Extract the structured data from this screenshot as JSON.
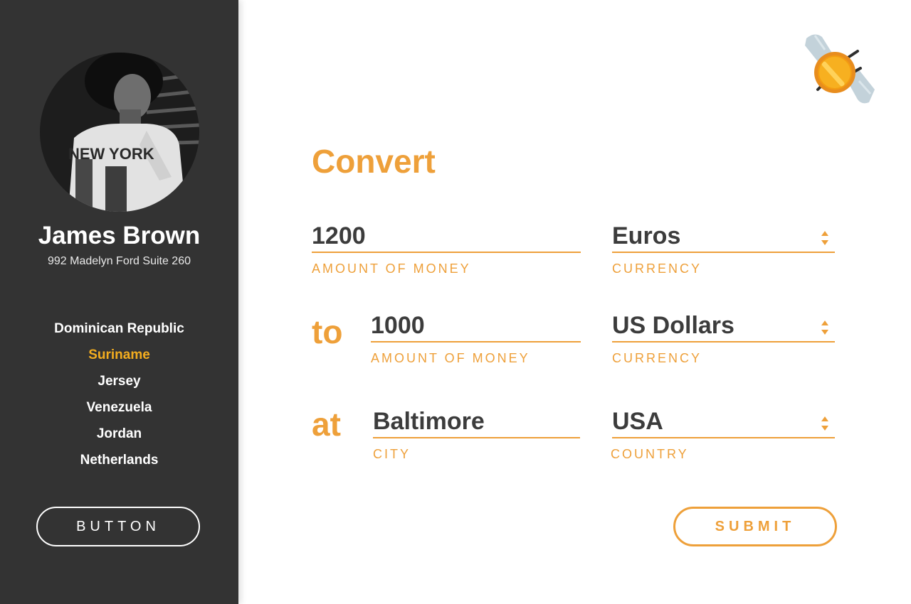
{
  "user": {
    "name": "James Brown",
    "address": "992 Madelyn Ford Suite 260",
    "avatar_shirt_text": "NEW YORK"
  },
  "nav": {
    "items": [
      {
        "label": "Dominican Republic",
        "active": false
      },
      {
        "label": "Suriname",
        "active": true
      },
      {
        "label": "Jersey",
        "active": false
      },
      {
        "label": "Venezuela",
        "active": false
      },
      {
        "label": "Jordan",
        "active": false
      },
      {
        "label": "Netherlands",
        "active": false
      }
    ]
  },
  "sidebar_button": "BUTTON",
  "logo": {
    "icon": "coin-bee-icon"
  },
  "form": {
    "title": "Convert",
    "from_amount": {
      "value": "1200",
      "label": "AMOUNT OF MONEY"
    },
    "from_currency": {
      "value": "Euros",
      "label": "CURRENCY"
    },
    "to_word": "to",
    "to_amount": {
      "value": "1000",
      "label": "AMOUNT OF MONEY"
    },
    "to_currency": {
      "value": "US Dollars",
      "label": "CURRENCY"
    },
    "at_word": "at",
    "city": {
      "value": "Baltimore",
      "label": "CITY"
    },
    "country": {
      "value": "USA",
      "label": "COUNTRY"
    },
    "submit_label": "SUBMIT"
  },
  "colors": {
    "sidebar_bg": "#333333",
    "accent": "#eea03a",
    "active_nav": "#f3ad1f",
    "value_text": "#3c3c3c"
  }
}
